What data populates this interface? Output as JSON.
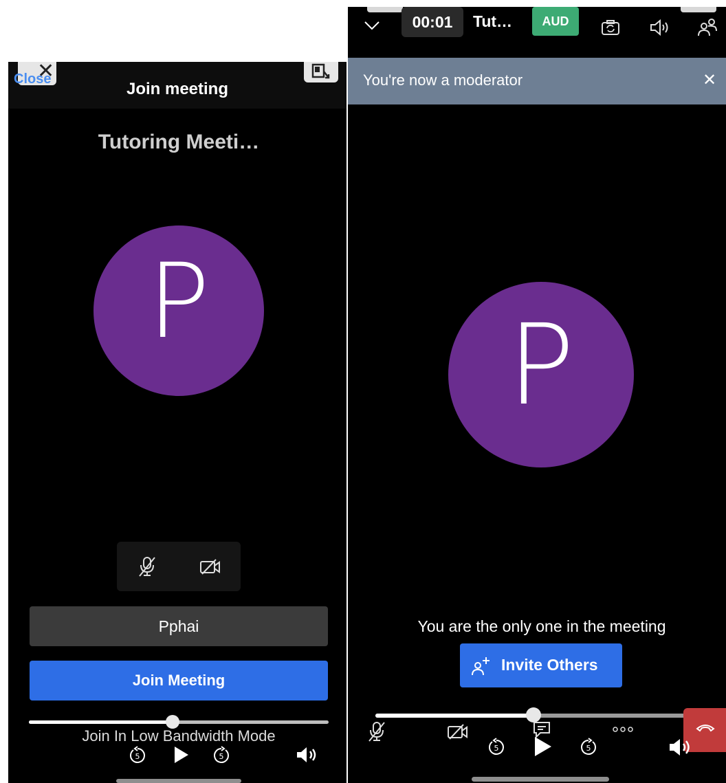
{
  "left": {
    "close_text": "Close",
    "title": "Join meeting",
    "meeting_name": "Tutoring Meeti…",
    "avatar_letter": "P",
    "avatar_color": "#6a2d8f",
    "name_value": "Pphai",
    "join_label": "Join Meeting",
    "join_color": "#2e6ee6",
    "low_bandwidth_label": "Join In Low Bandwidth Mode",
    "scrub_progress": 0.48
  },
  "right": {
    "timer": "00:01",
    "meeting_title": "Tut…",
    "audio_badge": "AUD",
    "audio_badge_color": "#3dab74",
    "banner_text": "You're now a moderator",
    "banner_color": "#6e7f94",
    "avatar_letter": "P",
    "alone_text": "You are the only one in the meeting",
    "invite_label": "Invite Others",
    "scrub_progress": 0.48,
    "end_call_color": "#c13b3b"
  },
  "icons": [
    "close-icon",
    "pip-icon",
    "mic-off-icon",
    "camera-off-icon",
    "replay-5-icon",
    "play-icon",
    "forward-5-icon",
    "volume-icon",
    "chevron-down-icon",
    "camera-switch-icon",
    "speaker-icon",
    "participants-icon",
    "add-person-icon",
    "chat-icon",
    "more-icon",
    "end-call-icon"
  ]
}
